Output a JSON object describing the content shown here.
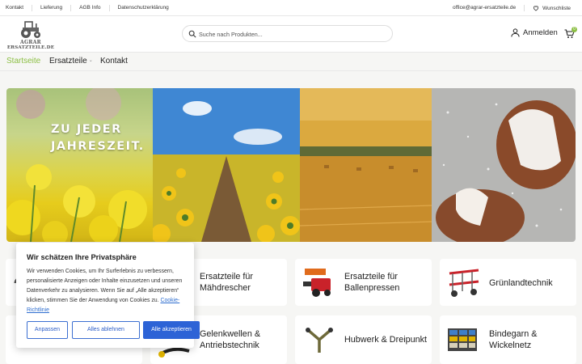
{
  "topbar": {
    "links": [
      "Kontakt",
      "Lieferung",
      "AGB Info",
      "Datenschutzerklärung"
    ],
    "email": "office@agrar-ersatzteile.de",
    "wishlist": "Wunschliste"
  },
  "logo": {
    "line1": "AGRAR",
    "line2": "ERSATZTEILE.DE"
  },
  "search": {
    "placeholder": "Suche nach Produkten..."
  },
  "account": {
    "label": "Anmelden"
  },
  "cart": {
    "count": "0"
  },
  "nav": {
    "items": [
      "Startseite",
      "Ersatzteile",
      "Kontakt"
    ],
    "active": "Startseite"
  },
  "hero": {
    "line1": "ZU JEDER",
    "line2": "JAHRESZEIT."
  },
  "categories": [
    {
      "label1": "Ersatzteile für",
      "label2": "Mähdrescher",
      "icon": "combine-parts"
    },
    {
      "label1": "Ersatzteile für",
      "label2": "Ballenpressen",
      "icon": "baler-parts"
    },
    {
      "label1": "Grünlandtechnik",
      "label2": "",
      "icon": "mower-rake"
    },
    {
      "label1": "Gelenkwellen &",
      "label2": "Antriebstechnik",
      "icon": "pto-shaft"
    },
    {
      "label1": "Hubwerk & Dreipunkt",
      "label2": "",
      "icon": "three-point-hitch"
    },
    {
      "label1": "Bindegarn &",
      "label2": "Wickelnetz",
      "icon": "twine-net"
    }
  ],
  "cookie": {
    "title": "Wir schätzen Ihre Privatsphäre",
    "text": "Wir verwenden Cookies, um Ihr Surferlebnis zu verbessern, personalisierte Anzeigen oder Inhalte einzusetzen und unseren Datenverkehr zu analysieren. Wenn Sie auf „Alle akzeptieren“ klicken, stimmen Sie der Anwendung von Cookies zu.",
    "link": "Cookie-Richtlinie",
    "buttons": {
      "customize": "Anpassen",
      "reject": "Alles ablehnen",
      "accept": "Alle akzeptieren"
    }
  },
  "colors": {
    "accent": "#8cbf44",
    "primary_button": "#2d63d6"
  }
}
